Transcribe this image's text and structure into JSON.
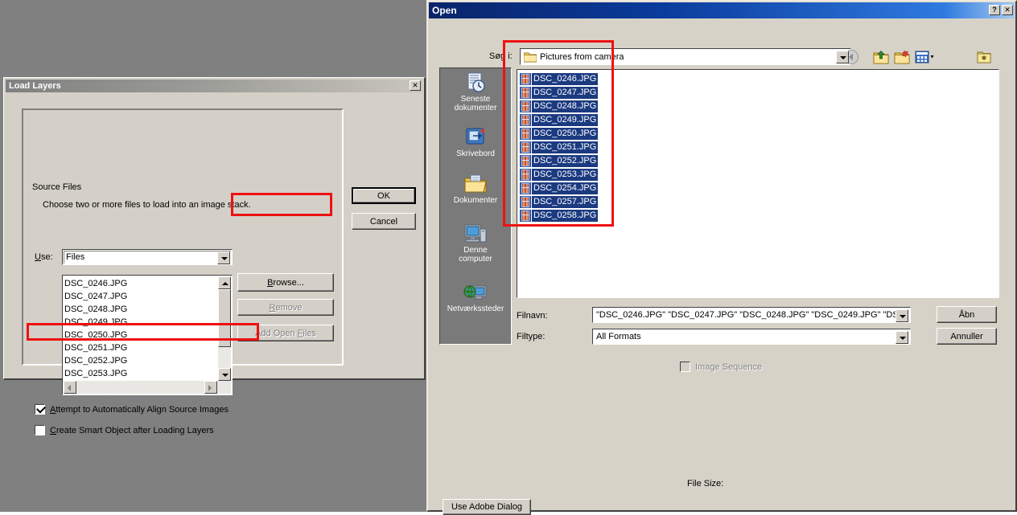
{
  "desktop": {
    "bg_color": "#808080"
  },
  "load_layers": {
    "title": "Load Layers",
    "close_label": "✕",
    "group_legend": "Source Files",
    "description": "Choose two or more files to load into an image stack.",
    "use_label_prefix": "U",
    "use_label_rest": "se:",
    "use_value": "Files",
    "files": [
      "DSC_0246.JPG",
      "DSC_0247.JPG",
      "DSC_0248.JPG",
      "DSC_0249.JPG",
      "DSC_0250.JPG",
      "DSC_0251.JPG",
      "DSC_0252.JPG",
      "DSC_0253.JPG"
    ],
    "buttons": {
      "ok": "OK",
      "cancel": "Cancel",
      "browse_prefix": "B",
      "browse_rest": "rowse...",
      "remove_prefix": "R",
      "remove_rest": "emove",
      "add_open_files_a": "Add Open ",
      "add_open_files_f": "F",
      "add_open_files_rest": "iles"
    },
    "checkboxes": {
      "align_prefix": "A",
      "align_rest": "ttempt to Automatically Align Source Images",
      "align_checked": true,
      "smart_prefix": "C",
      "smart_rest": "reate Smart Object after Loading Layers",
      "smart_checked": false
    }
  },
  "open_dialog": {
    "title": "Open",
    "help_label": "?",
    "close_label": "✕",
    "lookin_label": "Søg i:",
    "lookin_value": "Pictures from camera",
    "toolbar": {
      "back": "back-icon",
      "up": "up-one-level-icon",
      "new_folder": "new-folder-icon",
      "views": "views-icon",
      "adobe": "adobe-folder-icon"
    },
    "places": [
      {
        "label_line1": "Seneste",
        "label_line2": "dokumenter",
        "icon": "recent-documents-icon"
      },
      {
        "label_line1": "Skrivebord",
        "label_line2": "",
        "icon": "desktop-icon"
      },
      {
        "label_line1": "Dokumenter",
        "label_line2": "",
        "icon": "documents-folder-icon"
      },
      {
        "label_line1": "Denne",
        "label_line2": "computer",
        "icon": "my-computer-icon"
      },
      {
        "label_line1": "Netværkssteder",
        "label_line2": "",
        "icon": "network-places-icon"
      }
    ],
    "files": [
      "DSC_0246.JPG",
      "DSC_0247.JPG",
      "DSC_0248.JPG",
      "DSC_0249.JPG",
      "DSC_0250.JPG",
      "DSC_0251.JPG",
      "DSC_0252.JPG",
      "DSC_0253.JPG",
      "DSC_0254.JPG",
      "DSC_0257.JPG",
      "DSC_0258.JPG"
    ],
    "filename_label": "Filnavn:",
    "filename_value": "\"DSC_0246.JPG\" \"DSC_0247.JPG\" \"DSC_0248.JPG\" \"DSC_0249.JPG\" \"DS",
    "filetype_label": "Filtype:",
    "filetype_value": "All Formats",
    "open_button": "Åbn",
    "cancel_button": "Annuller",
    "image_sequence_label": "Image Sequence",
    "image_sequence_checked": false,
    "file_size_label": "File Size:",
    "use_adobe_dialog_button": "Use Adobe Dialog"
  },
  "annotations": {
    "highlight_color": "#ee1111",
    "boxes": [
      "browse-button",
      "align-checkbox",
      "open-file-list"
    ]
  }
}
